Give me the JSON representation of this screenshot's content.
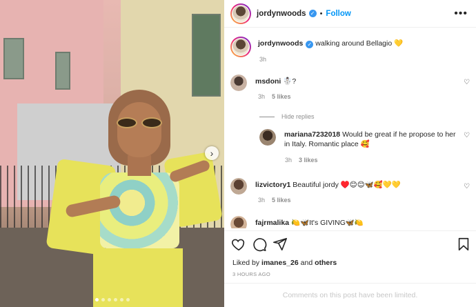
{
  "post": {
    "author": "jordynwoods",
    "follow_label": "Follow",
    "separator": "•",
    "more_label": "•••",
    "caption": "walking around Bellagio 💛",
    "caption_time": "3h"
  },
  "comments": [
    {
      "user": "msdoni",
      "text": "☃️?",
      "time": "3h",
      "likes": "5 likes"
    },
    {
      "user": "mariana7232018",
      "text": "Would be great if he propose to her in Italy. Romantic place 🥰",
      "time": "3h",
      "likes": "3 likes"
    },
    {
      "user": "lizvictory1",
      "text": "Beautiful jordy ♥️😊😊🦋🥰💛💛",
      "time": "3h",
      "likes": "5 likes"
    },
    {
      "user": "fajrmalika",
      "text": "🍋🦋It's GIVING🦋🍋"
    }
  ],
  "hide_replies_label": "Hide replies",
  "likes_line": {
    "prefix": "Liked by ",
    "user": "imanes_26",
    "and": " and ",
    "others": "others"
  },
  "post_time": "3 HOURS AGO",
  "comments_limited": "Comments on this post have been limited.",
  "icons": {
    "like": "heart-icon",
    "comment": "comment-icon",
    "share": "send-icon",
    "save": "bookmark-icon",
    "next": "chevron-right-icon",
    "verified": "verified-badge-icon"
  },
  "colors": {
    "accent": "#0095f6",
    "muted": "#8e8e8e",
    "verified": "#3897f0"
  },
  "carousel": {
    "total_slides": 6,
    "current_slide": 1
  }
}
